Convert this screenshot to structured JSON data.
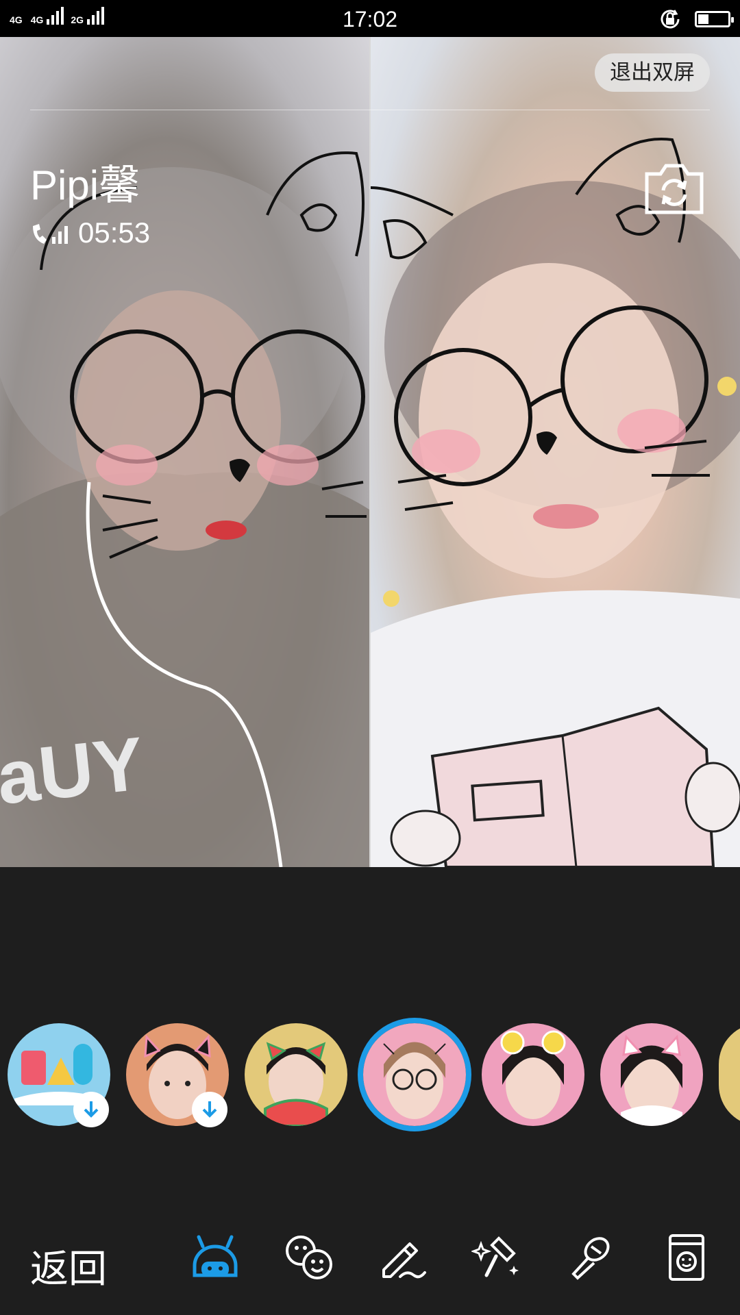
{
  "status_bar": {
    "signal1_label": "4G",
    "signal2_label": "4G",
    "signal3_label": "2G",
    "time": "17:02",
    "battery_level_fraction": 0.35
  },
  "call": {
    "exit_dual_label": "退出双屏",
    "caller_name": "Pipi馨",
    "duration": "05:53"
  },
  "filters": [
    {
      "name": "cartoon-friends",
      "download": true,
      "selected": false,
      "bg": "#8fd1ee"
    },
    {
      "name": "cat-ears-orange",
      "download": true,
      "selected": false,
      "bg": "#e39a73"
    },
    {
      "name": "watermelon",
      "download": false,
      "selected": false,
      "bg": "#e3c97a"
    },
    {
      "name": "cat-glasses",
      "download": false,
      "selected": true,
      "bg": "#f1a7be"
    },
    {
      "name": "lemon",
      "download": false,
      "selected": false,
      "bg": "#ef9fbd"
    },
    {
      "name": "white-cat-ears",
      "download": false,
      "selected": false,
      "bg": "#f0a3c0"
    }
  ],
  "toolbar": {
    "back_label": "返回",
    "tools": [
      "sticker-face-icon",
      "emoji-icon",
      "pen-icon",
      "beauty-brush-icon",
      "magic-wand-icon",
      "background-card-icon"
    ],
    "active_tool": "sticker-face-icon",
    "accent_color": "#1c9be6"
  }
}
